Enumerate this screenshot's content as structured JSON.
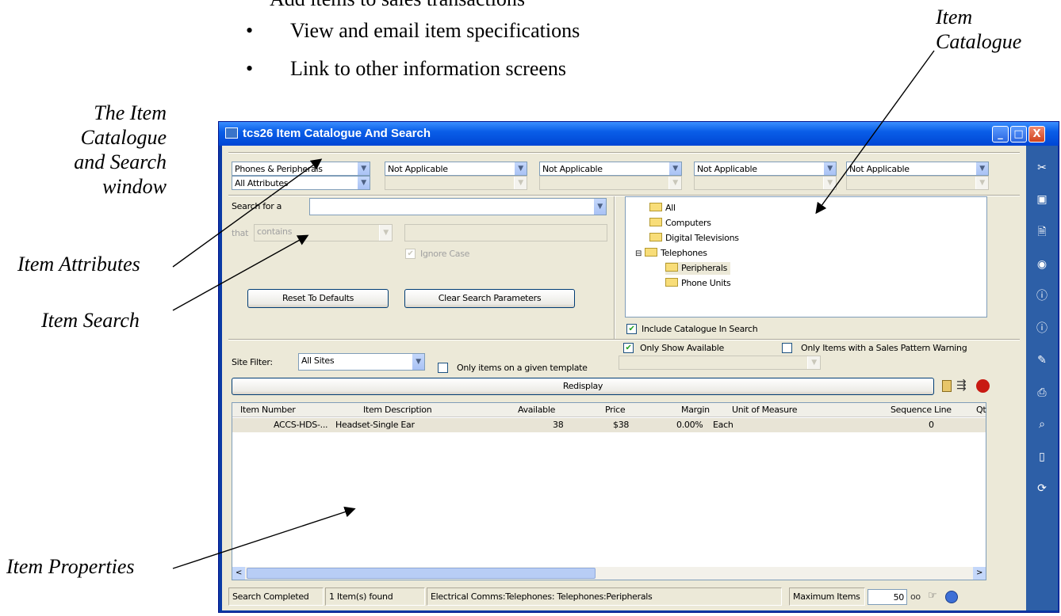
{
  "document": {
    "cut_line": "Add items to sales transactions",
    "bullets": [
      "View and email item specifications",
      "Link to other information screens"
    ]
  },
  "callouts": {
    "window_label": [
      "The Item",
      "Catalogue",
      "and Search",
      "window"
    ],
    "catalogue_label": [
      "Item",
      "Catalogue"
    ],
    "attributes_label": "Item Attributes",
    "search_label": "Item Search",
    "properties_label": "Item Properties"
  },
  "window": {
    "title": "tcs26 Item Catalogue And Search",
    "controls": {
      "minimize": "_",
      "maximize": "□",
      "close": "X"
    }
  },
  "filters": {
    "category": "Phones & Peripherals",
    "attributes": "All Attributes",
    "dropdowns": [
      "Not Applicable",
      "Not Applicable",
      "Not Applicable",
      "Not Applicable"
    ]
  },
  "search": {
    "search_for_label": "Search for a",
    "search_value": "",
    "that_label": "that",
    "condition": "contains",
    "condition_value": "",
    "ignore_case_label": "Ignore Case",
    "ignore_case_checked": true,
    "reset_button": "Reset To Defaults",
    "clear_button": "Clear Search Parameters"
  },
  "catalogue": {
    "items": [
      "All",
      "Computers",
      "Digital Televisions",
      "Telephones",
      "Peripherals",
      "Phone Units"
    ],
    "expander": "⊟",
    "include_label": "Include Catalogue In Search",
    "include_checked": true
  },
  "site_filter": {
    "label": "Site Filter:",
    "value": "All Sites",
    "only_available_label": "Only Show Available",
    "only_available_checked": true,
    "sales_warning_label": "Only Items with a Sales Pattern Warning",
    "template_label": "Only items on a given template",
    "redisplay_button": "Redisplay"
  },
  "grid": {
    "columns": [
      "Item Number",
      "Item Description",
      "Available",
      "Price",
      "Margin",
      "Unit of Measure",
      "Sequence Line",
      "Qt"
    ],
    "rows": [
      {
        "item_number": "ACCS-HDS-...",
        "description": "Headset-Single Ear",
        "available": "38",
        "price": "$38",
        "margin": "0.00%",
        "uom": "Each",
        "sequence": "0"
      }
    ],
    "scroll_left": "<",
    "scroll_right": ">"
  },
  "status": {
    "state": "Search Completed",
    "count": "1 Item(s) found",
    "path": "Electrical Comms:Telephones: Telephones:Peripherals",
    "max_label": "Maximum Items",
    "max_value": "50"
  },
  "sidebar_icons": [
    "tools-icon",
    "report-icon",
    "document-icon",
    "globe-icon",
    "info-icon",
    "info-icon-2",
    "edit-icon",
    "print-icon",
    "zoom-icon",
    "page-icon",
    "refresh-icon"
  ],
  "colors": {
    "title_blue": "#0a5ee8",
    "sidebar_blue": "#2d5fa7",
    "client_bg": "#ece9d8"
  }
}
